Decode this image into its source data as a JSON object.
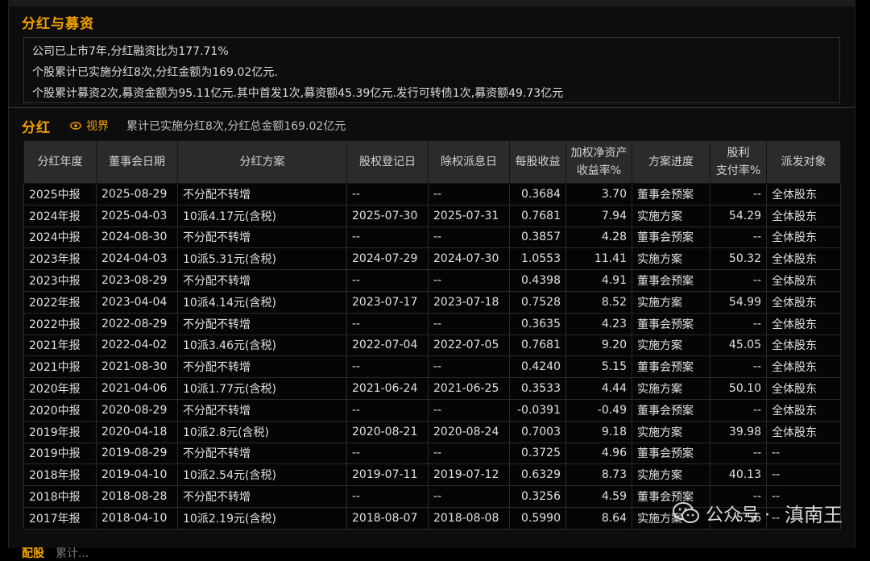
{
  "header": {
    "section_title": "分红与募资",
    "summary": [
      "公司已上市7年,分红融资比为177.71%",
      "个股累计已实施分红8次,分红金额为169.02亿元.",
      "个股累计募资2次,募资金额为95.11亿元.其中首发1次,募资额45.39亿元.发行可转债1次,募资额49.73亿元"
    ]
  },
  "dividend": {
    "title": "分红",
    "view_label": "视界",
    "summary": "累计已实施分红8次,分红总金额169.02亿元",
    "columns": [
      "分红年度",
      "董事会日期",
      "分红方案",
      "股权登记日",
      "除权派息日",
      "每股收益",
      "加权净资产收益率%",
      "方案进度",
      "股利支付率%",
      "派发对象"
    ],
    "column_lines": [
      [
        "分红年度"
      ],
      [
        "董事会日期"
      ],
      [
        "分红方案"
      ],
      [
        "股权登记日"
      ],
      [
        "除权派息日"
      ],
      [
        "每股收益"
      ],
      [
        "加权净资产",
        "收益率%"
      ],
      [
        "方案进度"
      ],
      [
        "股利",
        "支付率%"
      ],
      [
        "派发对象"
      ]
    ],
    "rows": [
      [
        "2025中报",
        "2025-08-29",
        "不分配不转增",
        "--",
        "--",
        "0.3684",
        "3.70",
        "董事会预案",
        "--",
        "全体股东"
      ],
      [
        "2024年报",
        "2025-04-03",
        "10派4.17元(含税)",
        "2025-07-30",
        "2025-07-31",
        "0.7681",
        "7.94",
        "实施方案",
        "54.29",
        "全体股东"
      ],
      [
        "2024中报",
        "2024-08-30",
        "不分配不转增",
        "--",
        "--",
        "0.3857",
        "4.28",
        "董事会预案",
        "--",
        "全体股东"
      ],
      [
        "2023年报",
        "2024-04-03",
        "10派5.31元(含税)",
        "2024-07-29",
        "2024-07-30",
        "1.0553",
        "11.41",
        "实施方案",
        "50.32",
        "全体股东"
      ],
      [
        "2023中报",
        "2023-08-29",
        "不分配不转增",
        "--",
        "--",
        "0.4398",
        "4.91",
        "董事会预案",
        "--",
        "全体股东"
      ],
      [
        "2022年报",
        "2023-04-04",
        "10派4.14元(含税)",
        "2023-07-17",
        "2023-07-18",
        "0.7528",
        "8.52",
        "实施方案",
        "54.99",
        "全体股东"
      ],
      [
        "2022中报",
        "2022-08-29",
        "不分配不转增",
        "--",
        "--",
        "0.3635",
        "4.23",
        "董事会预案",
        "--",
        "全体股东"
      ],
      [
        "2021年报",
        "2022-04-02",
        "10派3.46元(含税)",
        "2022-07-04",
        "2022-07-05",
        "0.7681",
        "9.20",
        "实施方案",
        "45.05",
        "全体股东"
      ],
      [
        "2021中报",
        "2021-08-30",
        "不分配不转增",
        "--",
        "--",
        "0.4240",
        "5.15",
        "董事会预案",
        "--",
        "全体股东"
      ],
      [
        "2020年报",
        "2021-04-06",
        "10派1.77元(含税)",
        "2021-06-24",
        "2021-06-25",
        "0.3533",
        "4.44",
        "实施方案",
        "50.10",
        "全体股东"
      ],
      [
        "2020中报",
        "2020-08-29",
        "不分配不转增",
        "--",
        "--",
        "-0.0391",
        "-0.49",
        "董事会预案",
        "--",
        "全体股东"
      ],
      [
        "2019年报",
        "2020-04-18",
        "10派2.8元(含税)",
        "2020-08-21",
        "2020-08-24",
        "0.7003",
        "9.18",
        "实施方案",
        "39.98",
        "全体股东"
      ],
      [
        "2019中报",
        "2019-08-29",
        "不分配不转增",
        "--",
        "--",
        "0.3725",
        "4.96",
        "董事会预案",
        "--",
        "--"
      ],
      [
        "2018年报",
        "2019-04-10",
        "10派2.54元(含税)",
        "2019-07-11",
        "2019-07-12",
        "0.6329",
        "8.73",
        "实施方案",
        "40.13",
        "--"
      ],
      [
        "2018中报",
        "2018-08-28",
        "不分配不转增",
        "--",
        "--",
        "0.3256",
        "4.59",
        "董事会预案",
        "--",
        "--"
      ],
      [
        "2017年报",
        "2018-04-10",
        "10派2.19元(含税)",
        "2018-08-07",
        "2018-08-08",
        "0.5990",
        "8.64",
        "实施方案",
        "5.56",
        "--"
      ]
    ]
  },
  "footer": {
    "next_section": "配股",
    "next_text": "累计..."
  },
  "watermark": {
    "account_label": "公众号 ·",
    "account_name": "滇南王"
  },
  "colors": {
    "accent": "#f0a000",
    "background": "#000000",
    "header_bg": "#2b2b2b"
  }
}
